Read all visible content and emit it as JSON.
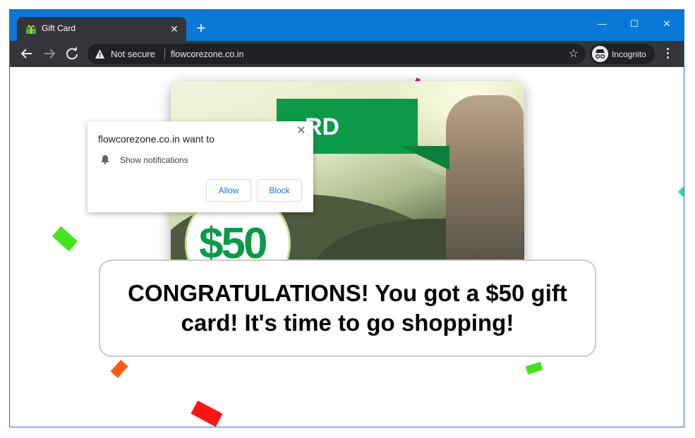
{
  "browser": {
    "tab_title": "Gift Card",
    "tab_close_glyph": "✕",
    "new_tab_glyph": "+",
    "window_controls": {
      "minimize": "—",
      "maximize": "☐",
      "close": "✕"
    },
    "security_label": "Not secure",
    "url": "flowcorezone.co.in",
    "incognito_label": "Incognito"
  },
  "permission_popup": {
    "title": "flowcorezone.co.in want to",
    "permission": "Show notifications",
    "close_glyph": "✕",
    "allow_label": "Allow",
    "block_label": "Block"
  },
  "gift_card": {
    "banner_text": "RD",
    "amount": "$50"
  },
  "message": {
    "text": "CONGRATULATIONS! You got a $50 gift card! It's time to go shopping!"
  },
  "colors": {
    "titlebar": "#0a78d7",
    "toolbar": "#35363a",
    "card_green": "#0d9a48",
    "link_blue": "#1a73e8"
  },
  "icons": [
    "gift-favicon-icon",
    "back-arrow-icon",
    "forward-arrow-icon",
    "reload-icon",
    "warning-icon",
    "star-icon",
    "incognito-icon",
    "kebab-menu-icon",
    "bell-icon",
    "close-icon"
  ]
}
